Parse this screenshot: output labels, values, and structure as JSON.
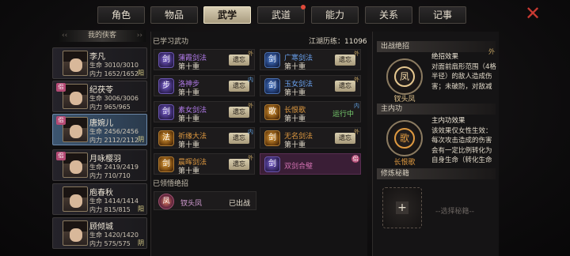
{
  "tabs": [
    {
      "label": "角色"
    },
    {
      "label": "物品"
    },
    {
      "label": "武学",
      "active": true
    },
    {
      "label": "武道",
      "dot": true
    },
    {
      "label": "能力"
    },
    {
      "label": "关系"
    },
    {
      "label": "记事"
    }
  ],
  "close_icon": "close-x-icon",
  "left": {
    "header": "我的侠客",
    "chars": [
      {
        "name": "李凡",
        "hp": "生命 3010/3010",
        "mp": "内力 1652/1652",
        "status": "阳",
        "badge": ""
      },
      {
        "name": "纪茯苓",
        "hp": "生命 3006/3006",
        "mp": "内力 965/965",
        "status": "",
        "badge": "侣"
      },
      {
        "name": "唐婉儿",
        "hp": "生命 2456/2456",
        "mp": "内力 2112/2112",
        "status": "阴",
        "badge": "侣"
      },
      {
        "name": "月咏樱羽",
        "hp": "生命 2419/2419",
        "mp": "内力 710/710",
        "status": "",
        "badge": "侣"
      },
      {
        "name": "庖春秋",
        "hp": "生命 1414/1414",
        "mp": "内力 815/815",
        "status": "阳",
        "badge": ""
      },
      {
        "name": "顾倾城",
        "hp": "生命 1420/1420",
        "mp": "内力 575/575",
        "status": "阴",
        "badge": ""
      }
    ]
  },
  "middle": {
    "learned_label": "已学习武功",
    "exp_label": "江湖历练：",
    "exp_value": "11096",
    "skills": [
      {
        "name": "蒲霞剑法",
        "level": "第十重",
        "action": "遗忘",
        "color": "purple",
        "tag": "外",
        "icon": "剑"
      },
      {
        "name": "广寒剑法",
        "level": "第十重",
        "action": "遗忘",
        "color": "blue",
        "tag": "外",
        "icon": "剑"
      },
      {
        "name": "洛神步",
        "level": "第十重",
        "action": "遗忘",
        "color": "purple",
        "tag": "内",
        "icon": "步"
      },
      {
        "name": "玉女剑法",
        "level": "第十重",
        "action": "遗忘",
        "color": "blue",
        "tag": "外",
        "icon": "剑"
      },
      {
        "name": "素女剑法",
        "level": "第十重",
        "action": "遗忘",
        "color": "purple",
        "tag": "外",
        "icon": "剑"
      },
      {
        "name": "长恨歌",
        "level": "第十重",
        "action": "运行中",
        "color": "orange",
        "tag": "内",
        "icon": "歌"
      },
      {
        "name": "祈缘大法",
        "level": "第十重",
        "action": "遗忘",
        "color": "orange",
        "tag": "内",
        "icon": "法"
      },
      {
        "name": "无名剑法",
        "level": "第十重",
        "action": "遗忘",
        "color": "orange",
        "tag": "外",
        "icon": "剑"
      },
      {
        "name": "晨晖剑法",
        "level": "第十重",
        "action": "遗忘",
        "color": "orange",
        "tag": "外",
        "icon": "剑"
      },
      {
        "name": "双剑合璧",
        "level": "",
        "action": "",
        "color": "pink",
        "tag": "侣",
        "icon": "剑"
      }
    ],
    "ult_label": "已领悟绝招",
    "ult": {
      "name": "钗头凤",
      "status": "已出战",
      "icon": "凤"
    }
  },
  "right": {
    "ult_header": "出战绝招",
    "ult_name": "钗头凤",
    "ult_desc_title": "绝招效果",
    "ult_desc": "对面前扇形范围（4格半径）的敌人造成伤害；未破防，对敌减",
    "inner_header": "主内功",
    "inner_name": "长恨歌",
    "inner_desc_title": "主内功效果",
    "inner_desc": "该效果仅女性生效：每次攻击造成的伤害会有一定比例转化为自身生命（转化生命",
    "secret_header": "修炼秘籍",
    "choose_label": "--选择秘籍--",
    "side_tag": "外"
  },
  "colors": {
    "accent": "#d8ceb4",
    "selected": "#3c5570",
    "purple": "#b07ae8",
    "blue": "#6aa2f0",
    "orange": "#e09a40",
    "pink": "#d070b0",
    "close": "#c83a32"
  }
}
